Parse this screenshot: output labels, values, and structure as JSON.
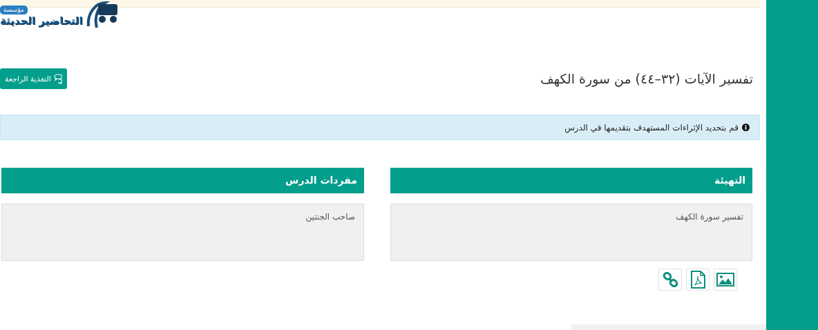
{
  "logo": {
    "badge": "مؤسسة",
    "name": "التحاضير الحديثة"
  },
  "lesson_title": "تفسير الآيات (٣٢–٤٤) من سورة الكهف",
  "feedback_button": {
    "label": "التغذية الراجعة"
  },
  "alert": {
    "text": "قم بتحديد الإثراءات المستهدف بتقديمها في الدرس"
  },
  "sections": [
    {
      "title": "التهيئة",
      "content": "تفسير سورة الكهف",
      "attachments": [
        {
          "kind": "image"
        },
        {
          "kind": "pdf"
        },
        {
          "kind": "link"
        }
      ]
    },
    {
      "title": "مفردات الدرس",
      "content": "صاحب الجنتين"
    }
  ]
}
